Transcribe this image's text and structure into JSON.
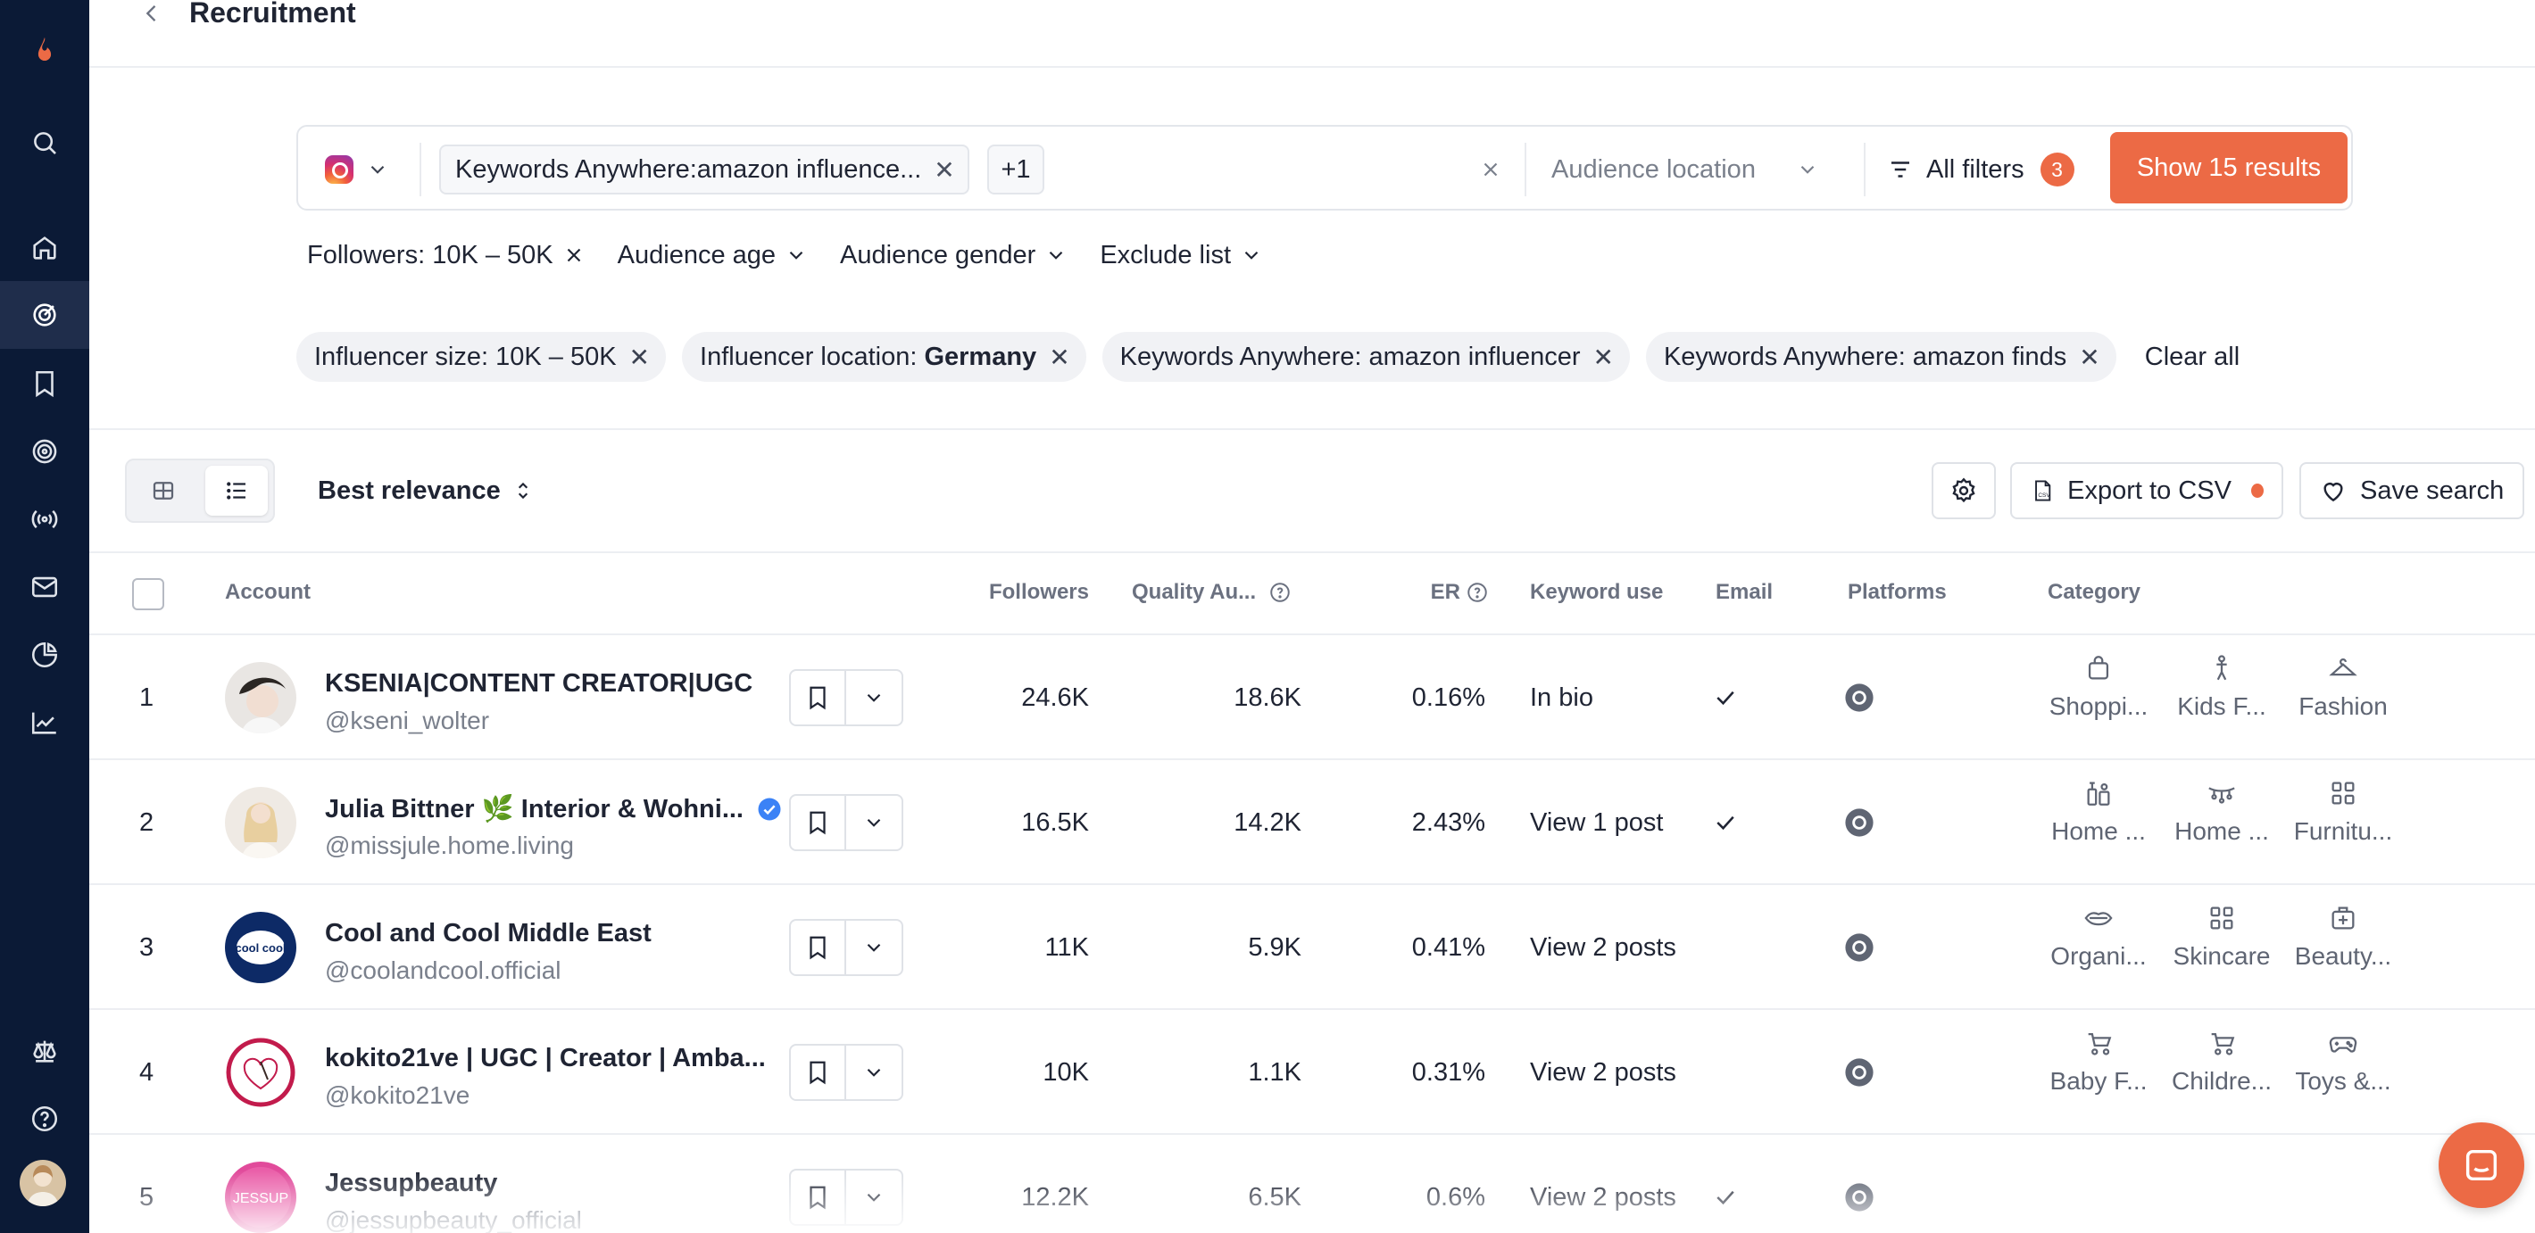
{
  "header": {
    "title": "Recruitment"
  },
  "sidebar": {
    "items": [
      "search",
      "home",
      "discover",
      "saved",
      "campaigns",
      "broadcast",
      "inbox",
      "reports",
      "analytics"
    ],
    "bottom": [
      "legal",
      "help",
      "avatar"
    ]
  },
  "search": {
    "platform": "instagram",
    "keyword_chip": "Keywords Anywhere:amazon influence...",
    "more_chip": "+1",
    "audience_location_placeholder": "Audience location",
    "all_filters_label": "All filters",
    "filters_count": "3",
    "show_results_label": "Show 15 results"
  },
  "dropdowns": {
    "followers": "Followers: 10K – 50K",
    "audience_age": "Audience age",
    "audience_gender": "Audience gender",
    "exclude_list": "Exclude list"
  },
  "active_filters": [
    {
      "label": "Influencer size: 10K – 50K",
      "bold": ""
    },
    {
      "label": "Influencer location:",
      "bold": "Germany"
    },
    {
      "label": "Keywords Anywhere: amazon influencer",
      "bold": ""
    },
    {
      "label": "Keywords Anywhere: amazon finds",
      "bold": ""
    }
  ],
  "clear_all": "Clear all",
  "toolbar": {
    "sort_label": "Best relevance",
    "export_label": "Export to CSV",
    "save_search_label": "Save search"
  },
  "table": {
    "headers": {
      "account": "Account",
      "followers": "Followers",
      "quality": "Quality Au...",
      "er": "ER",
      "keyword": "Keyword use",
      "email": "Email",
      "platforms": "Platforms",
      "category": "Category"
    },
    "rows": [
      {
        "num": "1",
        "name": "KSENIA|CONTENT CREATOR|UGC",
        "handle": "@kseni_wolter",
        "verified": false,
        "followers": "24.6K",
        "quality": "18.6K",
        "er": "0.16%",
        "keyword": "In bio",
        "email": true,
        "categories": [
          {
            "icon": "shopping-bag-icon",
            "label": "Shoppi..."
          },
          {
            "icon": "kids-icon",
            "label": "Kids F..."
          },
          {
            "icon": "hanger-icon",
            "label": "Fashion"
          }
        ]
      },
      {
        "num": "2",
        "name": "Julia Bittner 🌿 Interior & Wohni...",
        "handle": "@missjule.home.living",
        "verified": true,
        "followers": "16.5K",
        "quality": "14.2K",
        "er": "2.43%",
        "keyword": "View 1 post",
        "email": true,
        "categories": [
          {
            "icon": "home-tools-icon",
            "label": "Home ..."
          },
          {
            "icon": "home-decor-icon",
            "label": "Home ..."
          },
          {
            "icon": "furniture-grid-icon",
            "label": "Furnitu..."
          }
        ]
      },
      {
        "num": "3",
        "name": "Cool and Cool Middle East",
        "handle": "@coolandcool.official",
        "verified": false,
        "followers": "11K",
        "quality": "5.9K",
        "er": "0.41%",
        "keyword": "View 2 posts",
        "email": false,
        "categories": [
          {
            "icon": "lips-icon",
            "label": "Organi..."
          },
          {
            "icon": "skincare-grid-icon",
            "label": "Skincare"
          },
          {
            "icon": "beauty-kit-icon",
            "label": "Beauty..."
          }
        ]
      },
      {
        "num": "4",
        "name": "kokito21ve | UGC | Creator | Amba...",
        "handle": "@kokito21ve",
        "verified": false,
        "followers": "10K",
        "quality": "1.1K",
        "er": "0.31%",
        "keyword": "View 2 posts",
        "email": false,
        "categories": [
          {
            "icon": "stroller-icon",
            "label": "Baby F..."
          },
          {
            "icon": "stroller-icon",
            "label": "Childre..."
          },
          {
            "icon": "gamepad-icon",
            "label": "Toys &..."
          }
        ]
      },
      {
        "num": "5",
        "name": "Jessupbeauty",
        "handle": "@jessupbeauty_official",
        "verified": false,
        "followers": "12.2K",
        "quality": "6.5K",
        "er": "0.6%",
        "keyword": "View 2 posts",
        "email": true,
        "categories": []
      }
    ]
  },
  "avatars": {
    "r3_text": "cool cool",
    "r5_text": "JESSUP"
  },
  "colors": {
    "accent": "#ec6a45",
    "sidebar": "#0b1a36",
    "verified": "#3b82f6"
  }
}
